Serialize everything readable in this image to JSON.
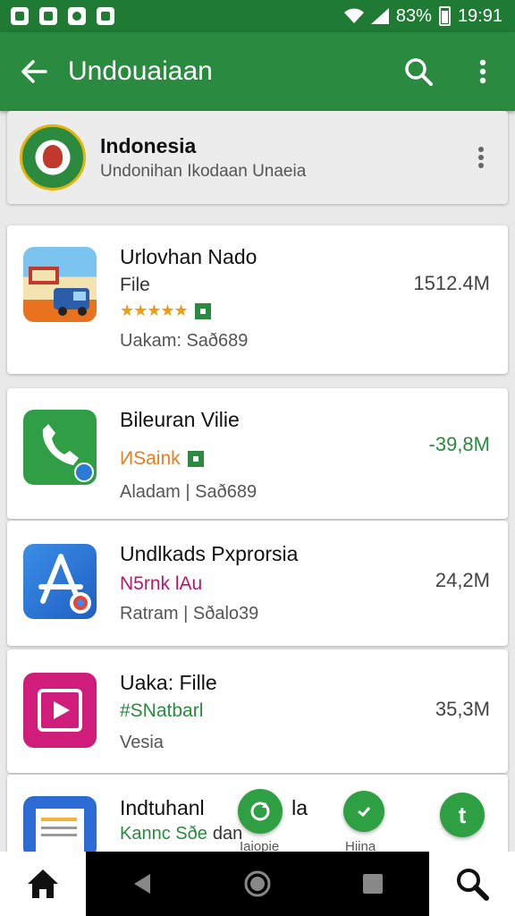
{
  "status_bar": {
    "battery": "83%",
    "time": "19:91"
  },
  "toolbar": {
    "title": "Undouaiaan"
  },
  "publisher": {
    "name": "Indonesia",
    "subtitle": "Undonihan Ikodaan Unaeia"
  },
  "apps": [
    {
      "name": "Urlovhan Nado",
      "line2": "File",
      "rating": "★★★★★",
      "line3": "Uakam: Sað689",
      "size": "1512.4M"
    },
    {
      "name": "Bileuran Vilie",
      "line2": "ИSaink",
      "line3": "Aladam | Sað689",
      "size": "-39,8M"
    },
    {
      "name": "Undlkads Pxprorsia",
      "line2": "N5rnk lAu",
      "line3": "Ratram | Sðalo39",
      "size": "24,2M"
    },
    {
      "name": "Uaka: Fille",
      "line2": "#SNatbarl",
      "line3": "Vesia",
      "size": "35,3M"
    },
    {
      "name": "Indtuhanl",
      "name_end": "la",
      "line2": "Kannc Sðe",
      "line2_end": "dan"
    }
  ],
  "bubbles": [
    {
      "label": "Iaiopie"
    },
    {
      "label": "Hiina"
    }
  ],
  "colors": {
    "primary": "#2a8a3f",
    "status": "#1f7a34",
    "accent_orange": "#e67e22",
    "size_green": "#2a8a3f"
  }
}
